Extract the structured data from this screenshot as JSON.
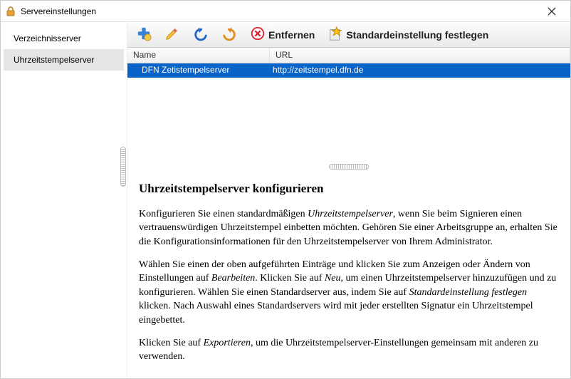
{
  "window": {
    "title": "Servereinstellungen",
    "icon": "lock-icon"
  },
  "sidebar": {
    "items": [
      {
        "label": "Verzeichnisserver",
        "selected": false
      },
      {
        "label": "Uhrzeitstempelserver",
        "selected": true
      }
    ]
  },
  "toolbar": {
    "add": {
      "name": "add-icon"
    },
    "edit": {
      "name": "edit-icon"
    },
    "undo": {
      "name": "undo-icon"
    },
    "redo": {
      "name": "redo-icon"
    },
    "remove": {
      "name": "remove-icon",
      "label": "Entfernen"
    },
    "default": {
      "name": "star-icon",
      "label": "Standardeinstellung festlegen"
    }
  },
  "table": {
    "columns": {
      "name": "Name",
      "url": "URL"
    },
    "rows": [
      {
        "name": "DFN Zetistempelserver",
        "url": "http://zeitstempel.dfn.de",
        "selected": true
      }
    ]
  },
  "help": {
    "heading": "Uhrzeitstempelserver konfigurieren",
    "p1a": "Konfigurieren Sie einen standardmäßigen ",
    "p1_term": "Uhrzeitstempelserver",
    "p1b": ", wenn Sie beim Signieren einen vertrauenswürdigen Uhrzeitstempel einbetten möchten. Gehören Sie einer Arbeitsgruppe an, erhalten Sie die Konfigurationsinformationen für den Uhrzeitstempelserver von Ihrem Administrator.",
    "p2a": "Wählen Sie einen der oben aufgeführten Einträge und klicken Sie zum Anzeigen oder Ändern von Einstellungen auf ",
    "p2_term1": "Bearbeiten",
    "p2b": ". Klicken Sie auf ",
    "p2_term2": "Neu",
    "p2c": ", um einen Uhrzeitstempelserver hinzuzufügen und zu konfigurieren. Wählen Sie einen Standardserver aus, indem Sie auf ",
    "p2_term3": "Standardeinstellung festlegen",
    "p2d": " klicken. Nach Auswahl eines Standardservers wird mit jeder erstellten Signatur ein Uhrzeitstempel eingebettet.",
    "p3a": "Klicken Sie auf ",
    "p3_term": "Exportieren",
    "p3b": ", um die Uhrzeitstempelserver-Einstellungen gemeinsam mit anderen zu verwenden."
  }
}
